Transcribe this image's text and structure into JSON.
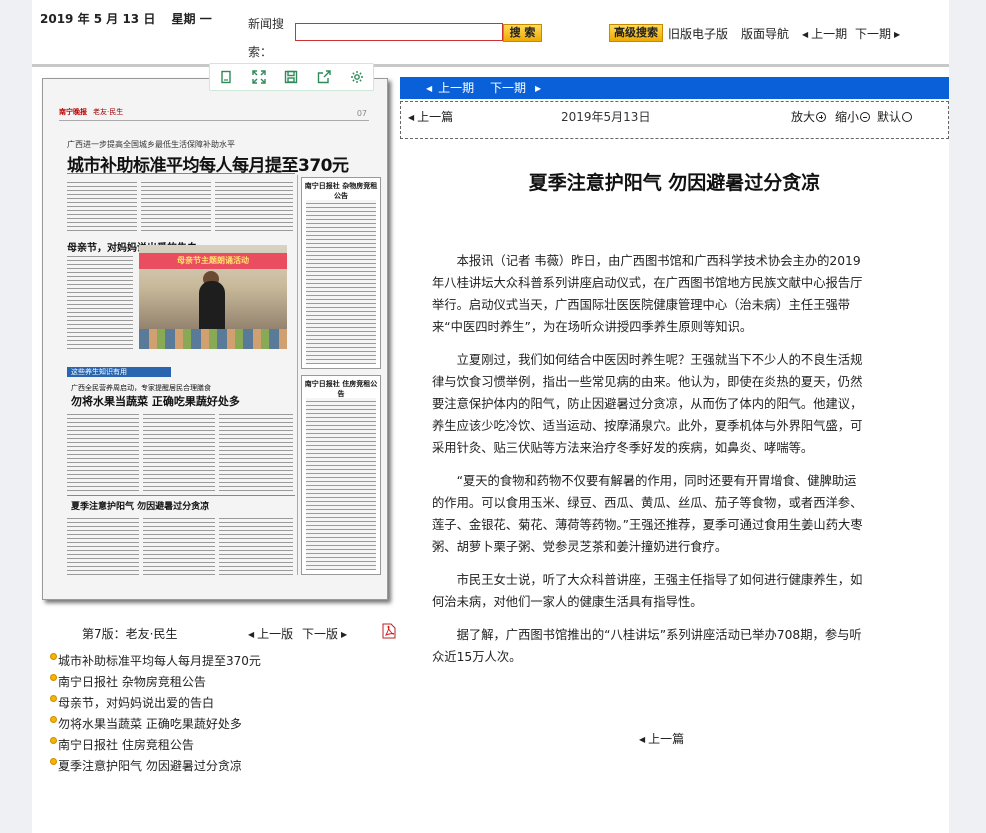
{
  "topbar": {
    "date": "2019 年 5 月 13 日",
    "weekday": "星期 一",
    "search_label": "新闻搜索：",
    "search_value": "",
    "search_button": "搜 索",
    "advanced_search": "高级搜索",
    "old_version": "旧版电子版",
    "page_nav": "版面导航",
    "prev_issue": "上一期",
    "next_issue": "下一期"
  },
  "newspaper": {
    "masthead": "南宁晚报",
    "section": "老友·民生",
    "page_no": "07",
    "subhead": "广西进一步提高全国城乡最低生活保障补助水平",
    "headline": "城市补助标准平均每人每月提至370元",
    "h2_mothers_day": "母亲节，对妈妈说出爱的告白",
    "photo_banner": "母亲节主题朗诵活动",
    "blue_tag": "这些养生知识有用",
    "h2_veg_sub": "广西全民营养周启动，专家提醒居民合理膳食",
    "h2_veg": "勿将水果当蔬菜 正确吃果蔬好处多",
    "h2_summer": "夏季注意护阳气 勿因避暑过分贪凉",
    "box1_title": "南宁日报社 杂物房竞租公告",
    "box2_title": "南宁日报社 住房竞租公告"
  },
  "toolbar": {
    "icons": [
      "page-view-icon",
      "fullscreen-icon",
      "save-icon",
      "share-icon",
      "settings-icon"
    ]
  },
  "page_nav": {
    "label": "第7版：老友·民生",
    "prev_page": "上一版",
    "next_page": "下一版"
  },
  "article_list": [
    "城市补助标准平均每人每月提至370元",
    "南宁日报社 杂物房竞租公告",
    "母亲节，对妈妈说出爱的告白",
    "勿将水果当蔬菜 正确吃果蔬好处多",
    "南宁日报社 住房竞租公告",
    "夏季注意护阳气 勿因避暑过分贪凉"
  ],
  "issue_bar": {
    "prev": "上一期",
    "next": "下一期"
  },
  "article_nav": {
    "prev": "上一篇",
    "date": "2019年5月13日",
    "zoom_in": "放大",
    "zoom_out": "缩小",
    "zoom_default": "默认"
  },
  "article": {
    "title": "夏季注意护阳气  勿因避暑过分贪凉",
    "paragraphs": [
      "本报讯（记者 韦薇）昨日，由广西图书馆和广西科学技术协会主办的2019年八桂讲坛大众科普系列讲座启动仪式，在广西图书馆地方民族文献中心报告厅举行。启动仪式当天，广西国际壮医医院健康管理中心（治未病）主任王强带来“中医四时养生”，为在场听众讲授四季养生原则等知识。",
      "立夏刚过，我们如何结合中医因时养生呢？王强就当下不少人的不良生活规律与饮食习惯举例，指出一些常见病的由来。他认为，即使在炎热的夏天，仍然要注意保护体内的阳气，防止因避暑过分贪凉，从而伤了体内的阳气。他建议，养生应该少吃冷饮、适当运动、按摩涌泉穴。此外，夏季机体与外界阳气盛，可采用针灸、贴三伏贴等方法来治疗冬季好发的疾病，如鼻炎、哮喘等。",
      "“夏天的食物和药物不仅要有解暑的作用，同时还要有开胃增食、健脾助运的作用。可以食用玉米、绿豆、西瓜、黄瓜、丝瓜、茄子等食物，或者西洋参、莲子、金银花、菊花、薄荷等药物。”王强还推荐，夏季可通过食用生姜山药大枣粥、胡萝卜栗子粥、党参灵芝茶和姜汁撞奶进行食疗。",
      "市民王女士说，听了大众科普讲座，王强主任指导了如何进行健康养生，如何治未病，对他们一家人的健康生活具有指导性。",
      "据了解，广西图书馆推出的“八桂讲坛”系列讲座活动已举办708期，参与听众近15万人次。"
    ],
    "bottom_prev": "上一篇"
  },
  "colors": {
    "accent_blue": "#0a60d8",
    "search_border": "#cc3333",
    "button_gold": "#f0a900",
    "bullet": "#f5b400"
  }
}
